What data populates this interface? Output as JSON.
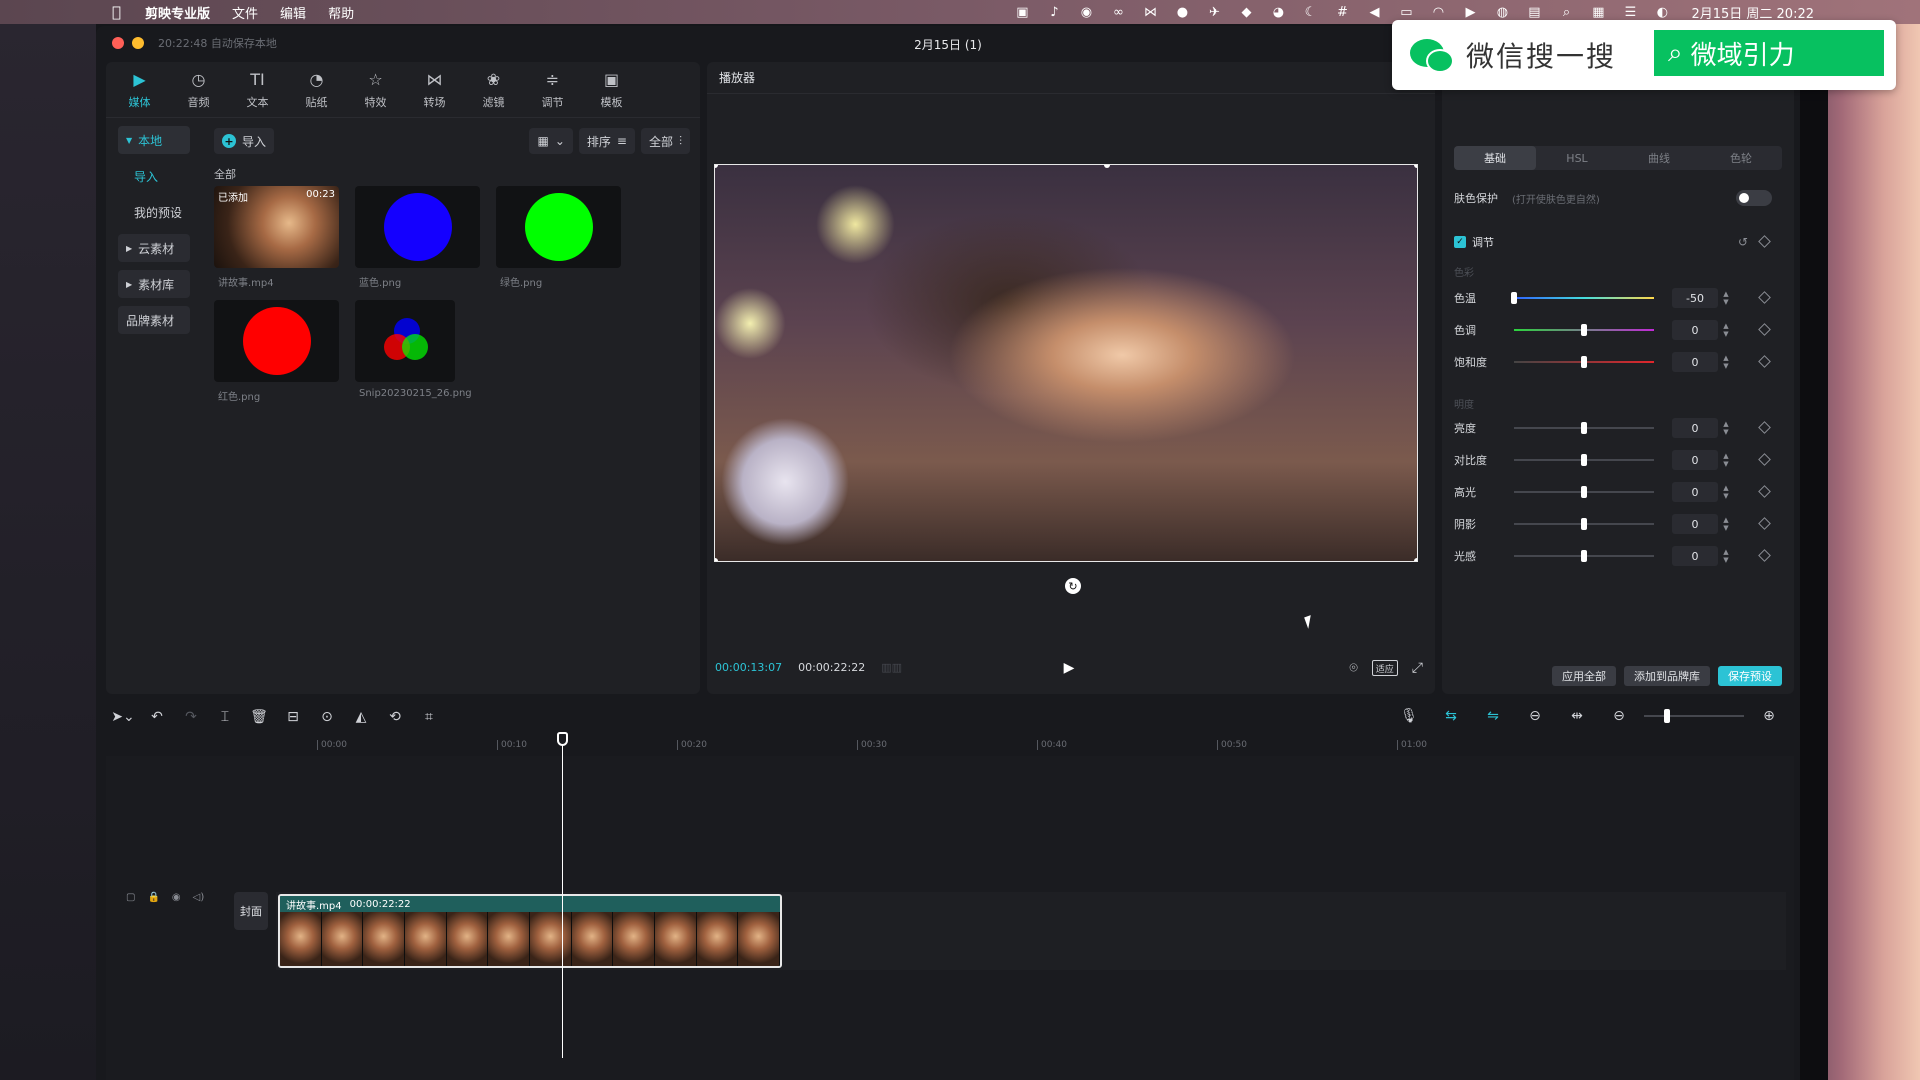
{
  "menubar": {
    "app_name": "剪映专业版",
    "items": [
      "文件",
      "编辑",
      "帮助"
    ],
    "clock": "2月15日 周二 20:22"
  },
  "window": {
    "autosave": "20:22:48 自动保存本地",
    "title": "2月15日 (1)"
  },
  "media": {
    "tabs": [
      {
        "label": "媒体",
        "icon": "media-icon"
      },
      {
        "label": "音频",
        "icon": "audio-icon"
      },
      {
        "label": "文本",
        "icon": "text-icon"
      },
      {
        "label": "贴纸",
        "icon": "sticker-icon"
      },
      {
        "label": "特效",
        "icon": "effects-icon"
      },
      {
        "label": "转场",
        "icon": "transition-icon"
      },
      {
        "label": "滤镜",
        "icon": "filter-icon"
      },
      {
        "label": "调节",
        "icon": "adjust-icon"
      },
      {
        "label": "模板",
        "icon": "template-icon"
      }
    ],
    "sidebar": [
      "本地",
      "导入",
      "我的预设",
      "云素材",
      "素材库",
      "品牌素材"
    ],
    "import_label": "导入",
    "sort_label": "排序",
    "filter_label": "全部",
    "all_label": "全部",
    "items": [
      {
        "name": "讲故事.mp4",
        "tag": "已添加",
        "duration": "00:23"
      },
      {
        "name": "蓝色.png",
        "color": "#1400ff"
      },
      {
        "name": "绿色.png",
        "color": "#00ff00"
      },
      {
        "name": "红色.png",
        "color": "#ff0000"
      },
      {
        "name": "Snip20230215_26.png"
      }
    ]
  },
  "player": {
    "title": "播放器",
    "current_time": "00:00:13:07",
    "total_time": "00:00:22:22",
    "fit_label": "适应"
  },
  "wechat": {
    "text": "微信搜一搜",
    "search": "微域引力"
  },
  "adjust": {
    "tabs": [
      "基础",
      "HSL",
      "曲线",
      "色轮"
    ],
    "skin_protect": "肤色保护",
    "skin_hint": "(打开使肤色更自然)",
    "adjust_label": "调节",
    "section_color": "色彩",
    "section_light": "明度",
    "params": [
      {
        "label": "色温",
        "value": "-50",
        "fraction": 0.0
      },
      {
        "label": "色调",
        "value": "0",
        "fraction": 0.5
      },
      {
        "label": "饱和度",
        "value": "0",
        "fraction": 0.5
      },
      {
        "label": "亮度",
        "value": "0",
        "fraction": 0.5
      },
      {
        "label": "对比度",
        "value": "0",
        "fraction": 0.5
      },
      {
        "label": "高光",
        "value": "0",
        "fraction": 0.5
      },
      {
        "label": "阴影",
        "value": "0",
        "fraction": 0.5
      },
      {
        "label": "光感",
        "value": "0",
        "fraction": 0.5
      }
    ],
    "apply_all": "应用全部",
    "add_brand": "添加到品牌库",
    "save_preset": "保存预设"
  },
  "timeline": {
    "ticks": [
      "00:00",
      "00:10",
      "00:20",
      "00:30",
      "00:40",
      "00:50",
      "01:00"
    ],
    "cover_label": "封面",
    "clip_name": "讲故事.mp4",
    "clip_duration": "00:00:22:22"
  }
}
